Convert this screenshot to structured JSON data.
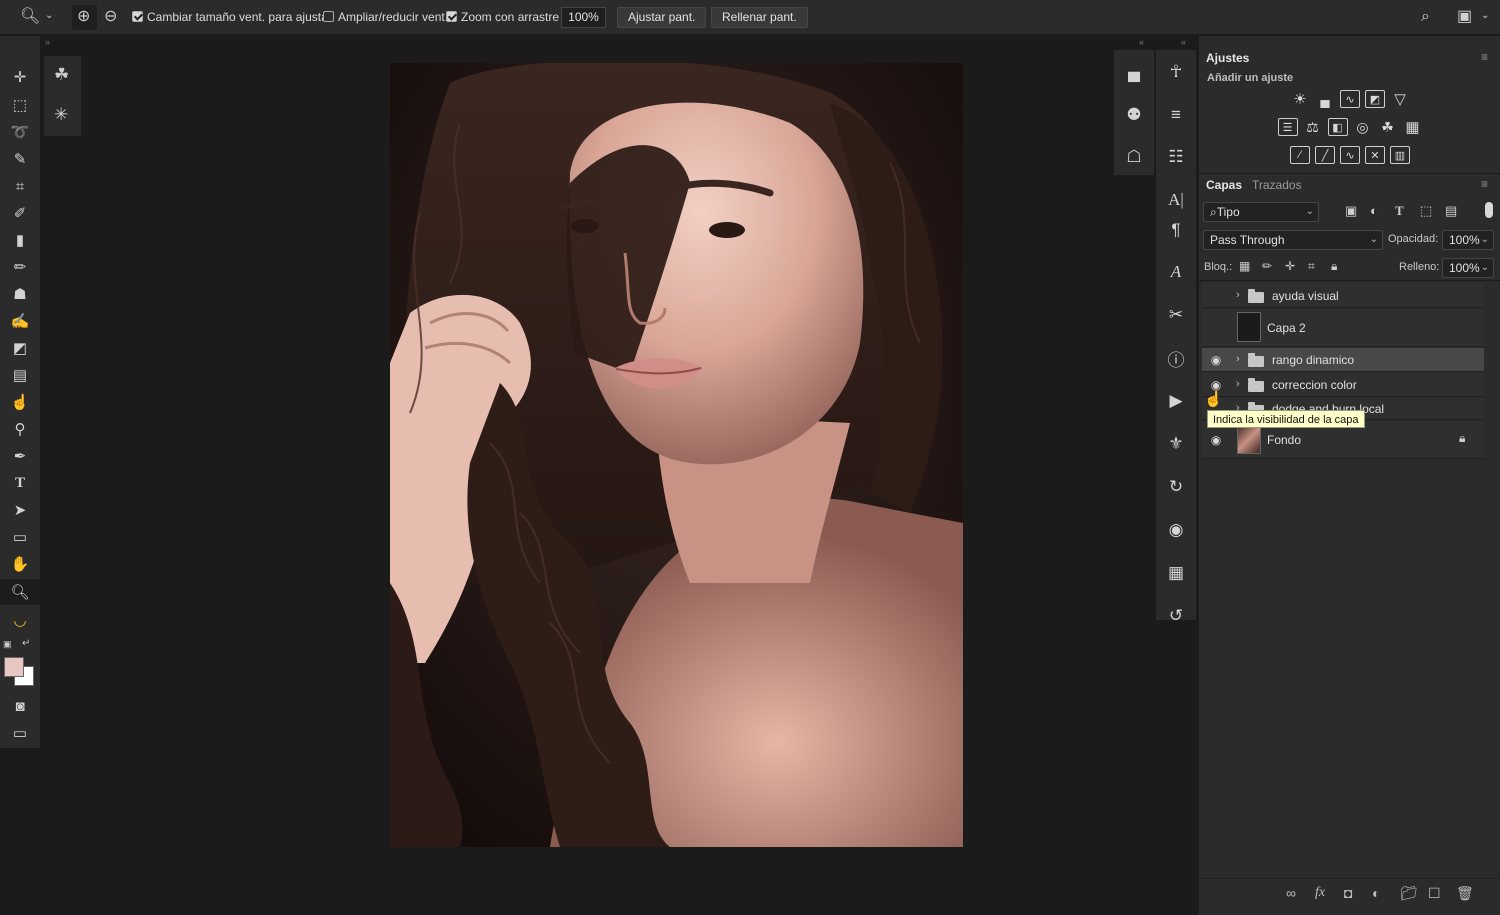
{
  "options_bar": {
    "zoom_tool_icon": "zoom-icon",
    "zoom_in_icon": "zoom-in-icon",
    "zoom_out_icon": "zoom-out-icon",
    "resize_windows_label": "Cambiar tamaño vent. para ajustar",
    "resize_windows_checked": true,
    "zoom_all_windows_label": "Ampliar/reducir vent.",
    "zoom_all_windows_checked": false,
    "scrubby_zoom_label": "Zoom con arrastre",
    "scrubby_zoom_checked": true,
    "zoom_value": "100%",
    "fit_screen_label": "Ajustar pant.",
    "fill_screen_label": "Rellenar pant."
  },
  "toolbar": {
    "tools": [
      "move-icon",
      "marquee-icon",
      "lasso-icon",
      "quick-select-icon",
      "crop-icon",
      "eyedropper-icon",
      "healing-icon",
      "brush-icon",
      "stamp-icon",
      "history-brush-icon",
      "eraser-icon",
      "gradient-icon",
      "smudge-icon",
      "dodge-icon",
      "pen-icon",
      "type-icon",
      "path-select-icon",
      "rectangle-icon",
      "hand-icon",
      "zoom-icon",
      "banana-icon"
    ],
    "active_tool": "zoom-icon",
    "foreground_color": "#e8c6c2",
    "background_color": "#ffffff"
  },
  "adjustments_panel": {
    "title": "Ajustes",
    "subtitle": "Añadir un ajuste"
  },
  "layers_panel": {
    "tabs": [
      "Capas",
      "Trazados"
    ],
    "filter_label": "Tipo",
    "blend_mode": "Pass Through",
    "opacity_label": "Opacidad:",
    "opacity_value": "100%",
    "lock_label": "Bloq.:",
    "fill_label": "Relleno:",
    "fill_value": "100%",
    "layers": [
      {
        "name": "ayuda visual",
        "kind": "group",
        "visible": false
      },
      {
        "name": "Capa 2",
        "kind": "layer",
        "visible": false
      },
      {
        "name": "rango dinamico",
        "kind": "group",
        "visible": true,
        "selected": true
      },
      {
        "name": "correccion color",
        "kind": "group",
        "visible": true
      },
      {
        "name": "dodge and burn local",
        "kind": "group",
        "visible": true
      },
      {
        "name": "Fondo",
        "kind": "background",
        "visible": true,
        "locked": true
      }
    ],
    "tooltip": "Indica la visibilidad de la capa"
  },
  "colors": {
    "ui_bg": "#2b2b2b",
    "workspace_bg": "#1b1b1b",
    "selected_layer": "#484848",
    "tooltip_bg": "#ffffc9"
  }
}
